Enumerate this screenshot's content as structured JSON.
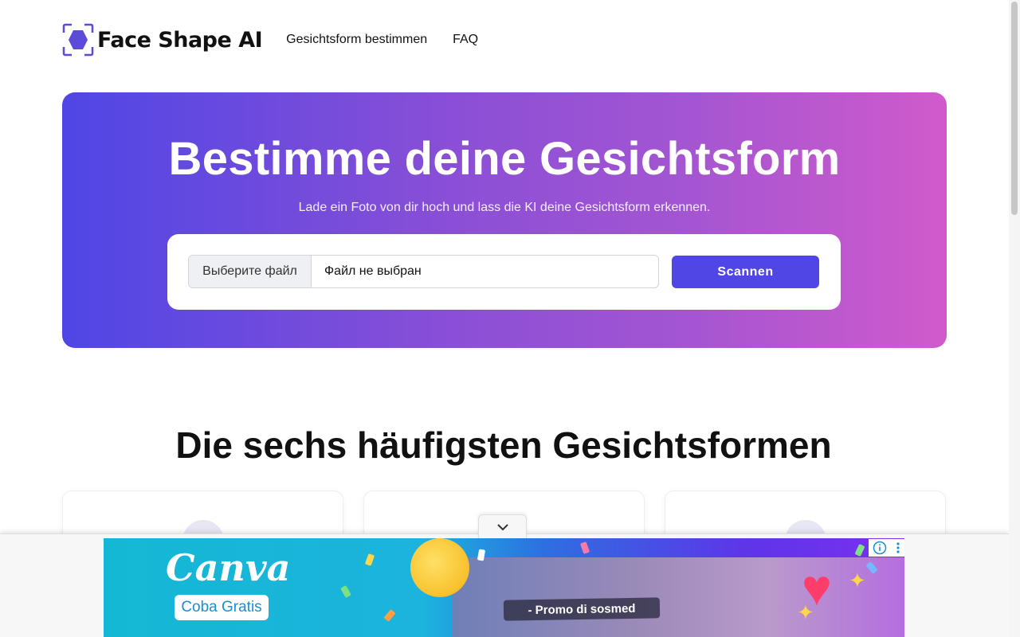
{
  "header": {
    "logo_text": "Face Shape AI",
    "nav": [
      {
        "label": "Gesichtsform bestimmen"
      },
      {
        "label": "FAQ"
      }
    ]
  },
  "hero": {
    "title": "Bestimme deine Gesichtsform",
    "subtitle": "Lade ein Foto von dir hoch und lass die KI deine Gesichtsform erkennen.",
    "file_button_label": "Выберите файл",
    "file_status": "Файл не выбран",
    "scan_button_label": "Scannen"
  },
  "section": {
    "title": "Die sechs häufigsten Gesichtsformen"
  },
  "ad": {
    "brand": "Canva",
    "cta": "Coba Gratis",
    "promo": "- Promo di sosmed"
  },
  "colors": {
    "accent": "#4f46e5",
    "hero_gradient_start": "#4f46e5",
    "hero_gradient_end": "#d15acb"
  },
  "icons": [
    "face-scan-logo-icon",
    "chevron-down-icon",
    "ad-info-icon",
    "ad-menu-icon"
  ]
}
